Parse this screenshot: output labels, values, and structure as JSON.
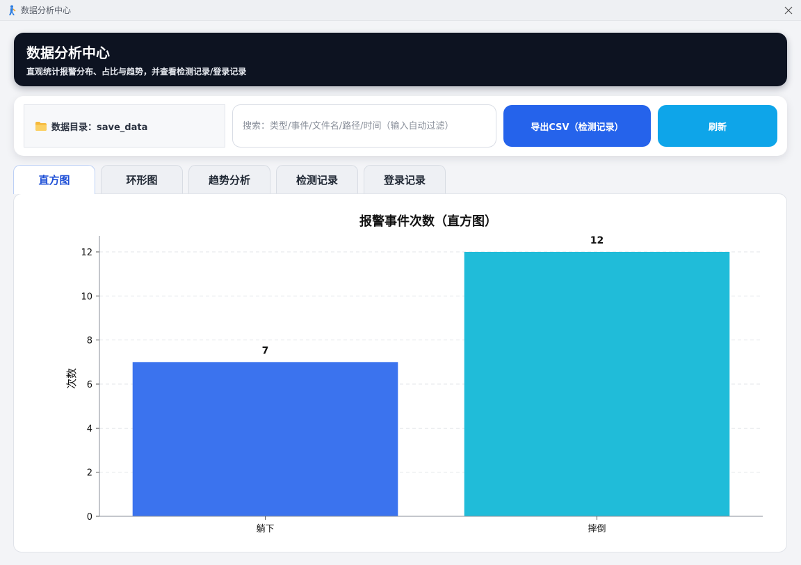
{
  "window": {
    "title": "数据分析中心"
  },
  "header": {
    "title": "数据分析中心",
    "subtitle": "直观统计报警分布、占比与趋势，并查看检测记录/登录记录"
  },
  "toolbar": {
    "data_dir_label": "数据目录：save_data",
    "search_placeholder": "搜索：类型/事件/文件名/路径/时间（输入自动过滤）",
    "search_value": "",
    "export_label": "导出CSV（检测记录）",
    "refresh_label": "刷新"
  },
  "tabs": [
    {
      "label": "直方图",
      "active": true
    },
    {
      "label": "环形图",
      "active": false
    },
    {
      "label": "趋势分析",
      "active": false
    },
    {
      "label": "检测记录",
      "active": false
    },
    {
      "label": "登录记录",
      "active": false
    }
  ],
  "icons": {
    "folder": "folder-icon",
    "close": "close-icon",
    "app": "app-logo-icon"
  },
  "colors": {
    "header_bg": "#0d1321",
    "accent_blue": "#2563eb",
    "accent_cyan": "#0ea5e9",
    "active_tab_text": "#1e4fd6"
  },
  "chart_data": {
    "type": "bar",
    "title": "报警事件次数（直方图）",
    "xlabel": "",
    "ylabel": "次数",
    "categories": [
      "躺下",
      "摔倒"
    ],
    "values": [
      7,
      12
    ],
    "bar_colors": [
      "#3b73ee",
      "#20bcd9"
    ],
    "data_labels": [
      "7",
      "12"
    ],
    "ylim": [
      0,
      12.6
    ],
    "yticks": [
      0,
      2,
      4,
      6,
      8,
      10,
      12
    ],
    "ytick_labels": [
      "0",
      "2",
      "4",
      "6",
      "8",
      "10",
      "12"
    ],
    "grid": true
  }
}
